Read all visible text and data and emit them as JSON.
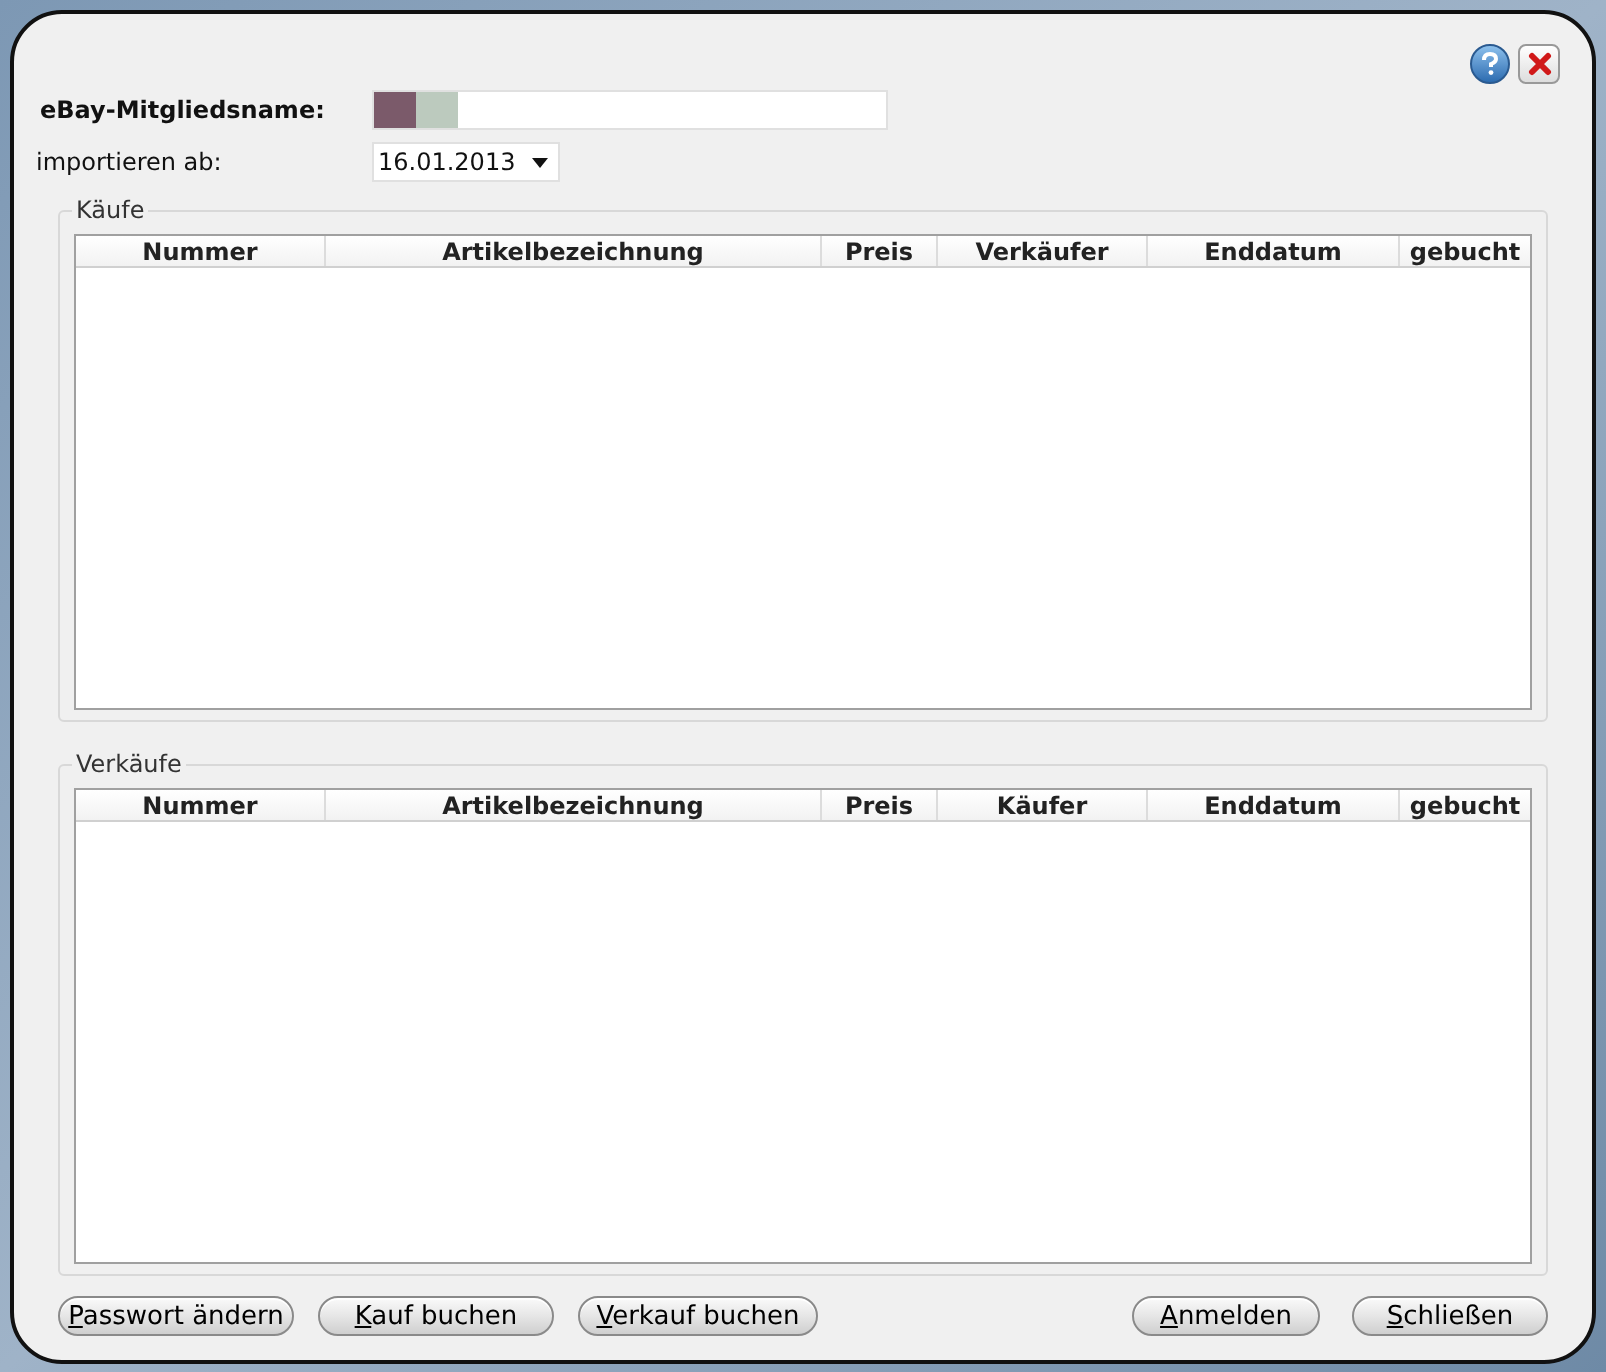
{
  "form": {
    "member_label": "eBay-Mitgliedsname:",
    "import_label": "importieren ab:",
    "import_date": "16.01.2013"
  },
  "sections": [
    {
      "title": "Käufe",
      "columns": [
        "Nummer",
        "Artikelbezeichnung",
        "Preis",
        "Verkäufer",
        "Enddatum",
        "gebucht"
      ]
    },
    {
      "title": "Verkäufe",
      "columns": [
        "Nummer",
        "Artikelbezeichnung",
        "Preis",
        "Käufer",
        "Enddatum",
        "gebucht"
      ]
    }
  ],
  "buttons_left": [
    {
      "mnemonic": "P",
      "rest": "asswort ändern"
    },
    {
      "mnemonic": "K",
      "rest": "auf buchen"
    },
    {
      "mnemonic": "V",
      "rest": "erkauf buchen"
    }
  ],
  "buttons_right": [
    {
      "mnemonic": "A",
      "rest": "nmelden"
    },
    {
      "mnemonic": "S",
      "rest": "chließen"
    }
  ]
}
